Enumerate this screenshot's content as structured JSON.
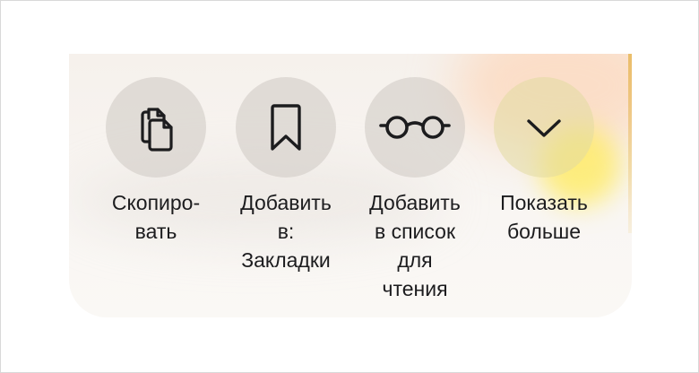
{
  "actions": [
    {
      "label": "Скопиро-\nвать",
      "icon": "copy-icon"
    },
    {
      "label": "Добавить\nв:\nЗакладки",
      "icon": "bookmark-icon"
    },
    {
      "label": "Добавить\nв список\nдля\nчтения",
      "icon": "glasses-icon"
    },
    {
      "label": "Показать\nбольше",
      "icon": "chevron-down-icon"
    }
  ],
  "colors": {
    "icon_stroke": "#1c1c1e",
    "circle_bg": "#cdc8c2",
    "text": "#1c1c1e"
  }
}
